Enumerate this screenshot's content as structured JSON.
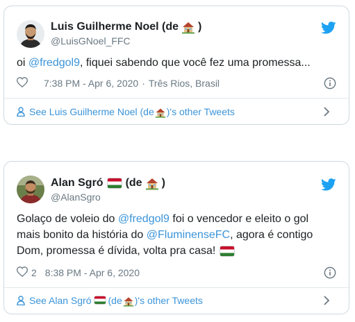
{
  "tweets": [
    {
      "author_name": "Luis Guilherme Noel (de",
      "author_name_end": ")",
      "handle": "@LuisGNoel_FFC",
      "text": [
        {
          "t": "oi ",
          "mention": false
        },
        {
          "t": "@fredgol9",
          "mention": true
        },
        {
          "t": ", fiquei sabendo que você fez uma promessa...",
          "mention": false
        }
      ],
      "time": "7:38 PM - Apr 6, 2020",
      "location": "Três Rios, Brasil",
      "see_more_prefix": "See Luis Guilherme Noel (de",
      "see_more_suffix": ")'s other Tweets"
    },
    {
      "author_name": "Alan Sgró",
      "author_name_mid": "(de",
      "author_name_end": ")",
      "handle": "@AlanSgro",
      "text_line1": [
        {
          "t": "Golaço de voleio do ",
          "mention": false
        },
        {
          "t": "@fredgol9",
          "mention": true
        },
        {
          "t": " foi o vencedor e eleito o gol",
          "mention": false
        }
      ],
      "text_line2": [
        {
          "t": "mais bonito da história do ",
          "mention": false
        },
        {
          "t": "@FluminenseFC",
          "mention": true
        },
        {
          "t": ", agora é contigo",
          "mention": false
        }
      ],
      "text_line3": "Dom, promessa é dívida, volta pra casa!",
      "likes": "2",
      "time": "8:38 PM - Apr 6, 2020",
      "see_more_prefix": "See Alan Sgró",
      "see_more_mid": "(de",
      "see_more_suffix": ")'s other Tweets"
    }
  ],
  "colors": {
    "link": "#3b94d9",
    "muted": "#697882",
    "border": "#cfd9de",
    "twitter_blue": "#1da1f2"
  },
  "icons": [
    "twitter-bird-icon",
    "heart-icon",
    "info-icon",
    "person-icon",
    "chevron-right-icon",
    "house-emoji-icon",
    "flag-emoji-icon"
  ]
}
